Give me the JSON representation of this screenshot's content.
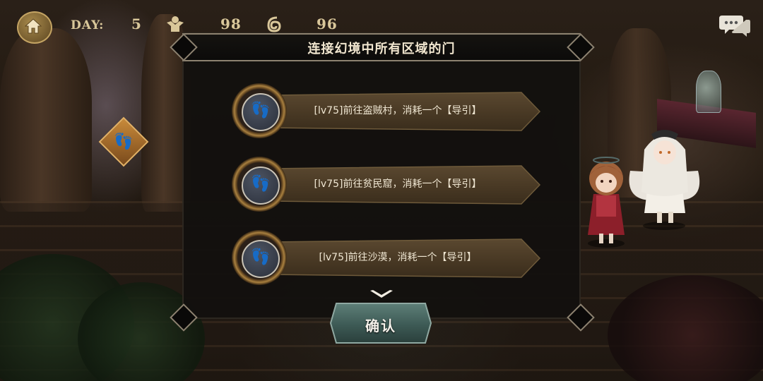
{
  "hud": {
    "day_label": "DAY:",
    "day_value": "5",
    "stat1_value": "98",
    "stat2_value": "96",
    "icons": [
      "home-icon",
      "person-icon",
      "swirl-icon",
      "chat-icon"
    ]
  },
  "dialog": {
    "title": "连接幻境中所有区域的门",
    "options": [
      {
        "label": "[lv75]前往盗贼村，消耗一个【导引】",
        "icon": "footprints-icon"
      },
      {
        "label": "[lv75]前往贫民窟，消耗一个【导引】",
        "icon": "footprints-icon"
      },
      {
        "label": "[lv75]前往沙漠，消耗一个【导引】",
        "icon": "footprints-icon"
      }
    ],
    "confirm_label": "确认"
  },
  "colors": {
    "hud_text": "#d9c79a",
    "banner": "#4a3a25",
    "confirm_button": "#3d5a55",
    "dialog_border": "#8d8270"
  }
}
